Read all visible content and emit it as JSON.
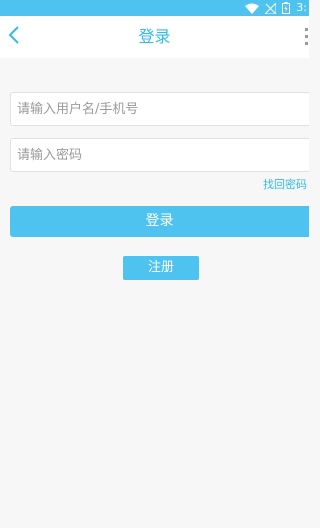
{
  "status_bar": {
    "time": "3:",
    "icons": [
      "wifi-icon",
      "signal-icon",
      "battery-icon"
    ],
    "color": "#4fc3f0"
  },
  "header": {
    "title": "登录",
    "back_icon": "chevron-left-icon",
    "menu_icon": "more-vertical-icon"
  },
  "form": {
    "username_placeholder": "请输入用户名/手机号",
    "username_value": "",
    "password_placeholder": "请输入密码",
    "password_value": "",
    "forgot_password": "找回密码",
    "login_label": "登录",
    "register_label": "注册"
  },
  "colors": {
    "accent": "#4fc3f0",
    "accent_text": "#33bbe8",
    "background": "#f7f7f7"
  }
}
